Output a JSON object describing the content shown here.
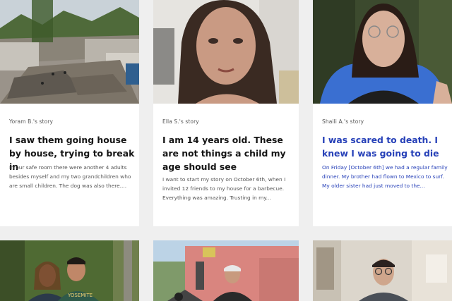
{
  "stories": [
    {
      "author": "Yoram B.'s story",
      "title": "I saw them going house by house, trying to break in",
      "excerpt": "In our safe room there were another 4 adults besides myself and my two grandchildren who are small children. The dog was also there....",
      "photo": "destroyed-street-photo"
    },
    {
      "author": "Ella S.'s story",
      "title": "I am 14 years old. These are not things a child my age should see",
      "excerpt": "I want to start my story on October 6th, when I invited 12 friends to my house for a barbecue. Everything was amazing. Trusting in my...",
      "photo": "girl-selfie-photo"
    },
    {
      "author": "Shaili A.'s story",
      "title": "I was scared to death. I knew I was going to die",
      "excerpt": "On Friday [October 6th] we had a regular family dinner. My brother had flown to Mexico to surf. My older sister had just moved to the...",
      "photo": "woman-glasses-photo",
      "hover": true
    },
    {
      "photo": "couple-outdoors-photo"
    },
    {
      "photo": "man-pink-house-photo"
    },
    {
      "photo": "person-kitchen-photo"
    }
  ],
  "colors": {
    "background": "#efefef",
    "card": "#ffffff",
    "title": "#141414",
    "hover_link": "#2741b8",
    "meta": "#555555"
  }
}
